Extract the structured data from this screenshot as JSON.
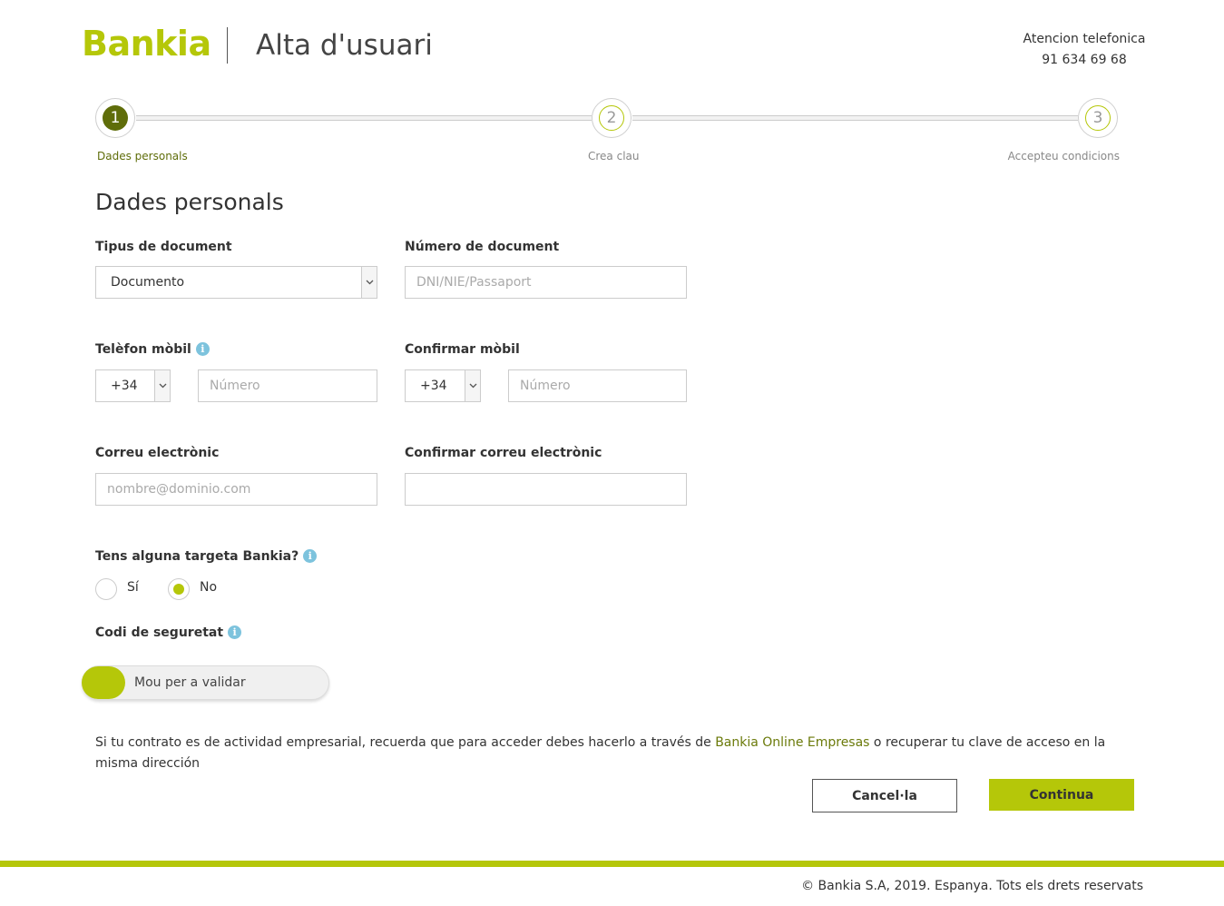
{
  "brand": {
    "logo": "Bankia",
    "color": "#b5c709"
  },
  "header": {
    "title": "Alta d'usuari",
    "contact_title": "Atencion telefonica",
    "contact_phone": "91 634 69 68"
  },
  "steps": [
    {
      "number": "1",
      "label": "Dades personals",
      "state": "active"
    },
    {
      "number": "2",
      "label": "Crea clau",
      "state": "pending"
    },
    {
      "number": "3",
      "label": "Accepteu condicions",
      "state": "pending"
    }
  ],
  "form": {
    "section_title": "Dades personals",
    "document_type": {
      "label": "Tipus de document",
      "value": "Documento"
    },
    "document_number": {
      "label": "Número de document",
      "placeholder": "DNI/NIE/Passaport"
    },
    "mobile": {
      "label": "Telèfon mòbil",
      "prefix": "+34",
      "placeholder": "Número"
    },
    "confirm_mobile": {
      "label": "Confirmar mòbil",
      "prefix": "+34",
      "placeholder": "Número"
    },
    "email": {
      "label": "Correu electrònic",
      "placeholder": "nombre@dominio.com"
    },
    "confirm_email": {
      "label": "Confirmar correu electrònic",
      "placeholder": ""
    },
    "has_card": {
      "label": "Tens alguna targeta Bankia?",
      "options": [
        "Sí",
        "No"
      ],
      "selected": "No"
    },
    "security": {
      "label": "Codi de seguretat",
      "slider_text": "Mou per a validar"
    }
  },
  "notice": {
    "before": "Si tu contrato es de actividad empresarial, recuerda que para acceder debes hacerlo a través de ",
    "link": "Bankia Online Empresas",
    "after": " o recuperar tu clave de acceso en la misma dirección"
  },
  "buttons": {
    "cancel": "Cancel·la",
    "continue": "Continua"
  },
  "footer": {
    "copyright": "© Bankia S.A, 2019. Espanya. Tots els drets reservats"
  },
  "icons": {
    "info": "info-icon",
    "dropdown": "chevron-down-icon"
  }
}
